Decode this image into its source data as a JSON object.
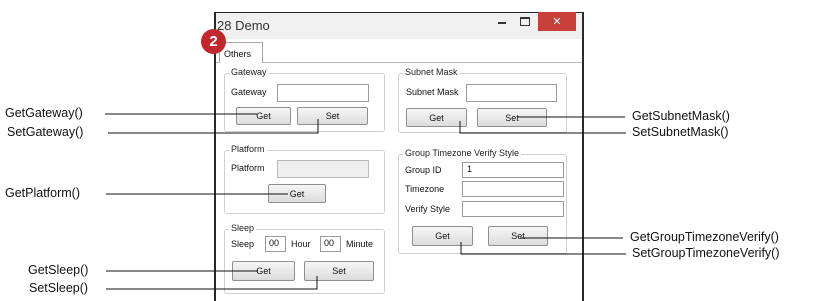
{
  "window": {
    "title": "28 Demo",
    "badge": "2",
    "tab": "Others",
    "minimize_icon": "minimize-icon",
    "maximize_icon": "maximize-icon",
    "close_icon": "close-icon",
    "close_symbol": "✕",
    "close_color": "#c9403a"
  },
  "gateway": {
    "group_title": "Gateway",
    "field_label": "Gateway",
    "value": "",
    "get_label": "Get",
    "set_label": "Set"
  },
  "platform": {
    "group_title": "Platform",
    "field_label": "Platform",
    "value": "",
    "get_label": "Get"
  },
  "sleep": {
    "group_title": "Sleep",
    "label": "Sleep",
    "hour_value": "00",
    "hour_label": "Hour",
    "minute_value": "00",
    "minute_label": "Minute",
    "get_label": "Get",
    "set_label": "Set"
  },
  "subnet": {
    "group_title": "Subnet Mask",
    "field_label": "Subnet Mask",
    "value": "",
    "get_label": "Get",
    "set_label": "Set"
  },
  "group_tz": {
    "group_title": "Group Timezone Verify Style",
    "group_id_label": "Group ID",
    "group_id_value": "1",
    "timezone_label": "Timezone",
    "timezone_value": "",
    "verify_style_label": "Verify Style",
    "verify_style_value": "",
    "get_label": "Get",
    "set_label": "Set"
  },
  "callouts": {
    "get_gateway": "GetGateway()",
    "set_gateway": "SetGateway()",
    "get_platform": "GetPlatform()",
    "get_sleep": "GetSleep()",
    "set_sleep": "SetSleep()",
    "get_subnet_mask": "GetSubnetMask()",
    "set_subnet_mask": "SetSubnetMask()",
    "get_group_tz": "GetGroupTimezoneVerify()",
    "set_group_tz": "SetGroupTimezoneVerify()"
  }
}
